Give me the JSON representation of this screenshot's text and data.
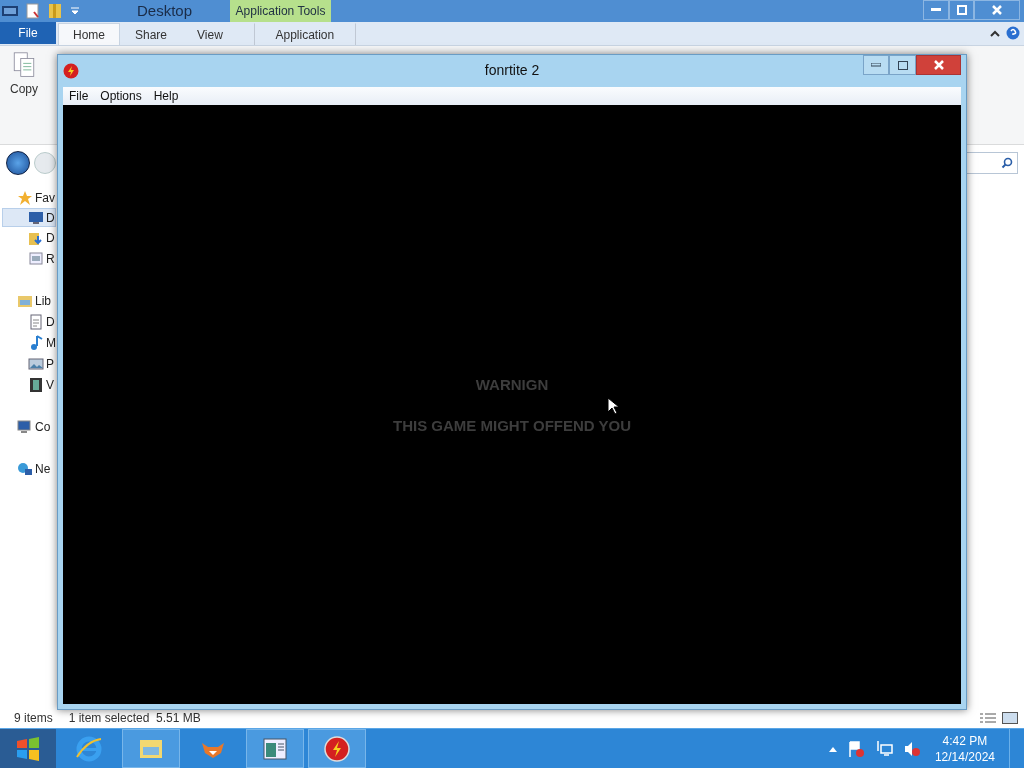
{
  "explorer": {
    "title": "Desktop",
    "contextual_tab": "Application Tools",
    "file_tab": "File",
    "tabs": [
      {
        "label": "Home",
        "selected": true
      },
      {
        "label": "Share",
        "selected": false
      },
      {
        "label": "View",
        "selected": false
      },
      {
        "label": "Application",
        "selected": false
      }
    ],
    "ribbon_buttons": [
      "Copy"
    ],
    "nav_tree": [
      {
        "label": "Fav",
        "kind": "star",
        "selected": false,
        "children": [
          {
            "label": "D",
            "kind": "monitor",
            "selected": true
          },
          {
            "label": "D",
            "kind": "download",
            "selected": false
          },
          {
            "label": "R",
            "kind": "places",
            "selected": false
          }
        ]
      },
      {
        "label": "Lib",
        "kind": "library",
        "selected": false,
        "children": [
          {
            "label": "D",
            "kind": "document",
            "selected": false
          },
          {
            "label": "M",
            "kind": "music",
            "selected": false
          },
          {
            "label": "P",
            "kind": "picture",
            "selected": false
          },
          {
            "label": "V",
            "kind": "film",
            "selected": false
          }
        ]
      },
      {
        "label": "Co",
        "kind": "computer",
        "selected": false
      },
      {
        "label": "Ne",
        "kind": "network",
        "selected": false
      }
    ],
    "status_count": "9 items",
    "status_selection": "1 item selected  5.51 MB"
  },
  "game_window": {
    "title": "fonrtite 2",
    "menu": [
      "File",
      "Options",
      "Help"
    ],
    "warning_title": "WARNIGN",
    "warning_message": "THIS GAME MIGHT OFFEND YOU"
  },
  "taskbar": {
    "apps": [
      {
        "kind": "browser",
        "running": false
      },
      {
        "kind": "files",
        "running": true
      },
      {
        "kind": "fox",
        "running": false
      },
      {
        "kind": "window",
        "running": true
      },
      {
        "kind": "game",
        "running": true
      }
    ],
    "clock_time": "4:42 PM",
    "clock_date": "12/14/2024"
  }
}
